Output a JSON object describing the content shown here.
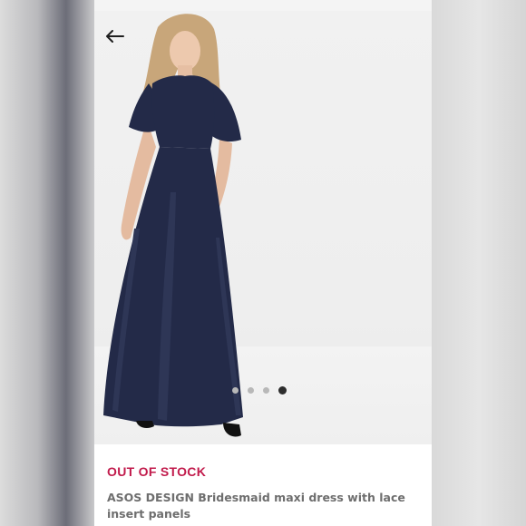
{
  "navigation": {
    "back_icon": "arrow-left-icon"
  },
  "gallery": {
    "image_alt": "Model wearing navy maxi dress with lace insert panels",
    "dots": [
      {
        "active": false
      },
      {
        "active": false
      },
      {
        "active": false
      },
      {
        "active": true
      }
    ]
  },
  "product": {
    "stock_status": "OUT OF STOCK",
    "title": "ASOS DESIGN Bridesmaid maxi dress with lace insert panels"
  },
  "colors": {
    "stock_status": "#c11a4b",
    "dress": "#232a48",
    "title_text": "#6e6e6e"
  }
}
